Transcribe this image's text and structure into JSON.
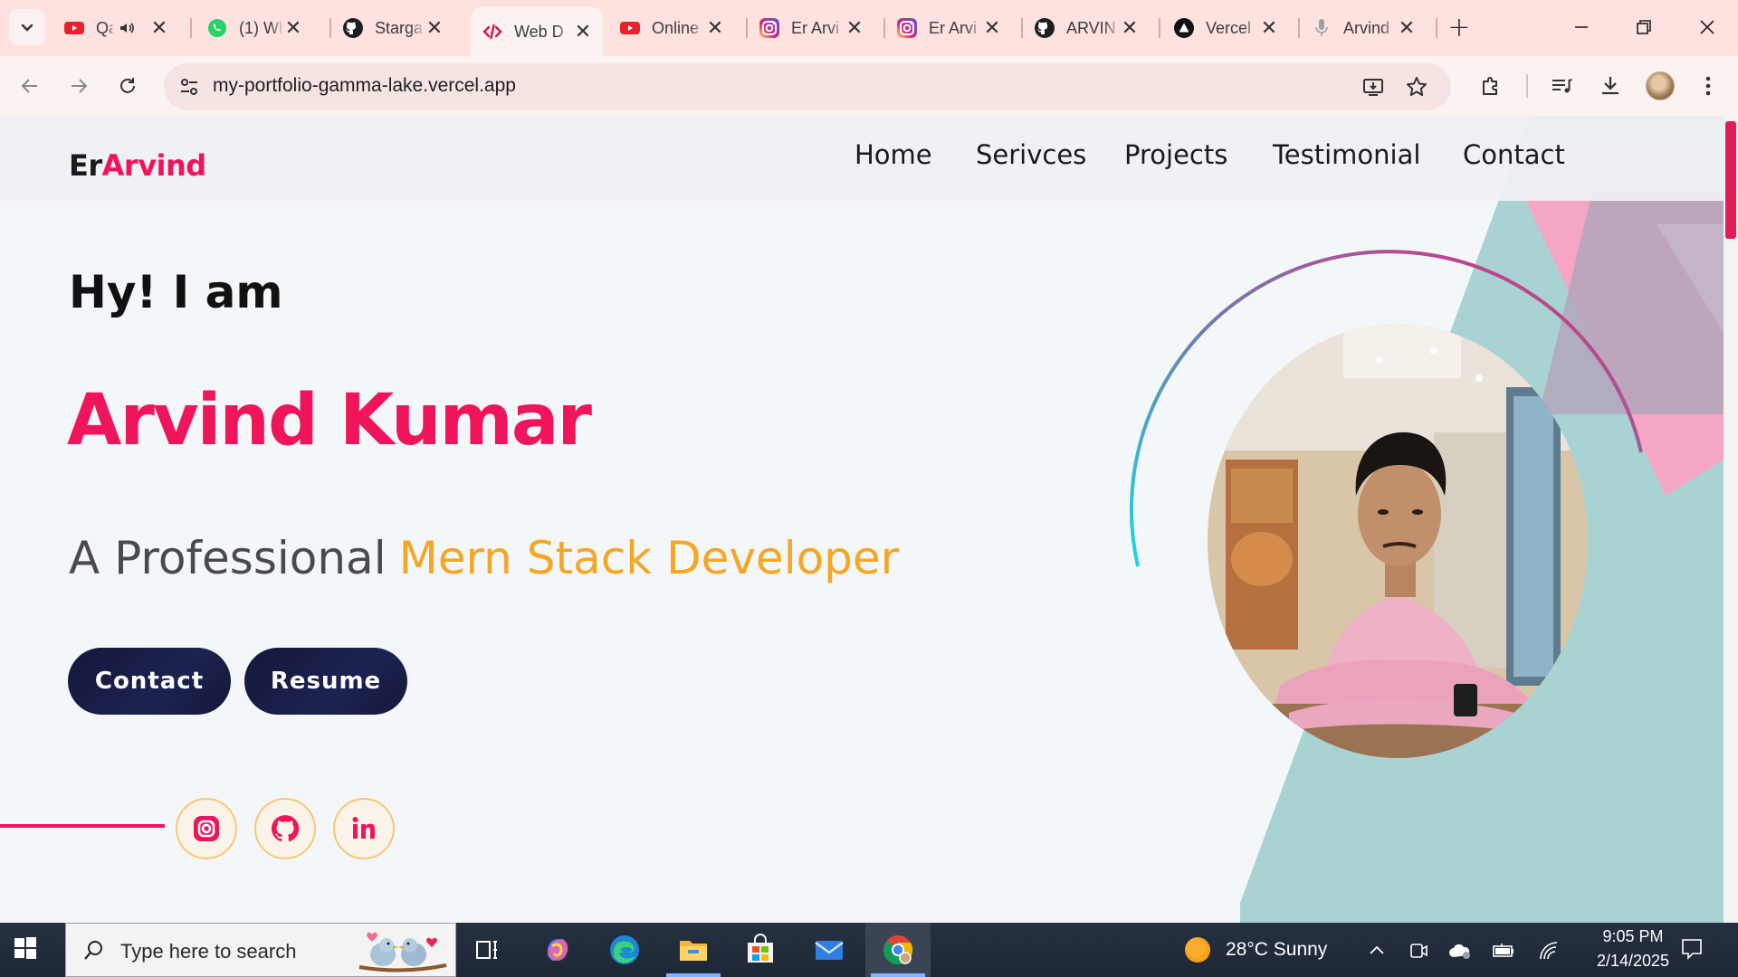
{
  "browser": {
    "tabs": [
      {
        "title": "Qa",
        "icon": "youtube-icon",
        "audio": true
      },
      {
        "title": "(1) Wh",
        "icon": "whatsapp-icon"
      },
      {
        "title": "Starga",
        "icon": "github-icon"
      },
      {
        "title": "Web D",
        "icon": "code-icon",
        "active": true
      },
      {
        "title": "Online",
        "icon": "youtube-icon"
      },
      {
        "title": "Er Arvi",
        "icon": "instagram-icon"
      },
      {
        "title": "Er Arvi",
        "icon": "instagram-icon"
      },
      {
        "title": "ARVIN",
        "icon": "github-icon"
      },
      {
        "title": "Vercel",
        "icon": "vercel-icon"
      },
      {
        "title": "Arvind",
        "icon": "microphone-icon"
      }
    ],
    "new_tab": "+",
    "url": "my-portfolio-gamma-lake.vercel.app",
    "close_glyph": "✕"
  },
  "site": {
    "brand_prefix": "Er",
    "brand_name": "Arvind",
    "nav": [
      "Home",
      "Serivces",
      "Projects",
      "Testimonial",
      "Contact"
    ],
    "greeting": "Hy! I am",
    "first_name": "Arvind",
    "last_name": "Kumar",
    "tagline_prefix": "A Professional",
    "tagline_role": "Mern Stack Developer",
    "buttons": {
      "contact": "Contact",
      "resume": "Resume"
    },
    "socials": [
      "instagram-icon",
      "github-icon",
      "linkedin-icon"
    ],
    "colors": {
      "accent": "#f0145a",
      "role": "#f5a623",
      "button": "#1a1f4a",
      "teal": "#a9d3d3",
      "pink": "#f4a6c4"
    }
  },
  "taskbar": {
    "search_placeholder": "Type here to search",
    "weather": "28°C  Sunny",
    "time": "9:05 PM",
    "date": "2/14/2025"
  }
}
